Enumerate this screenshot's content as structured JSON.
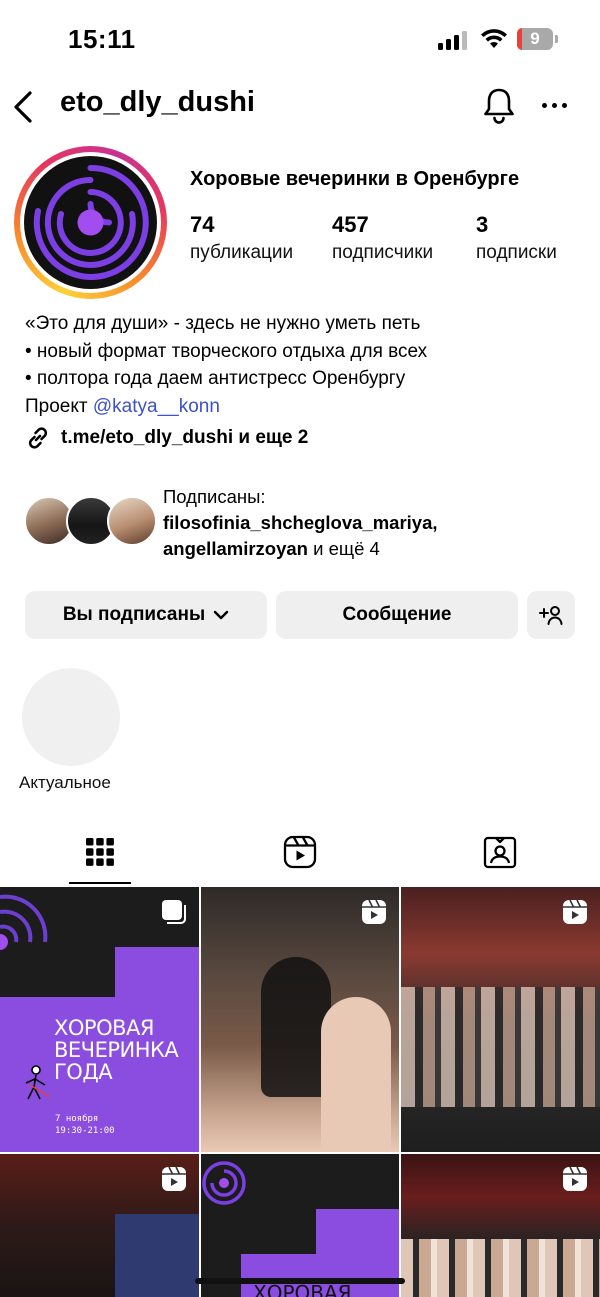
{
  "status_bar": {
    "time": "15:11",
    "battery": "9"
  },
  "header": {
    "username": "eto_dly_dushi"
  },
  "profile": {
    "name": "Хоровые вечеринки в Оренбурге",
    "stats": [
      {
        "value": "74",
        "label": "публикации"
      },
      {
        "value": "457",
        "label": "подписчики"
      },
      {
        "value": "3",
        "label": "подписки"
      }
    ],
    "bio_lines": [
      "«Это для души» - здесь не нужно уметь петь",
      "• новый формат творческого отдыха для всех",
      "• полтора года даем антистресс Оренбургу"
    ],
    "bio_project_prefix": "Проект ",
    "bio_mention": "@katya__konn",
    "link_text": "t.me/eto_dly_dushi и еще 2"
  },
  "followed_by": {
    "label": "Подписаны:",
    "names_line": "filosofinia_shcheglova_mariya,",
    "name2": "angellamirzoyan",
    "suffix": " и ещё 4"
  },
  "buttons": {
    "subscribed": "Вы подписаны",
    "message": "Сообщение"
  },
  "highlights": {
    "label": "Актуальное"
  },
  "tabs": [
    {
      "name": "posts",
      "icon": "grid-icon",
      "active": true
    },
    {
      "name": "reels",
      "icon": "reels-icon",
      "active": false
    },
    {
      "name": "tagged",
      "icon": "tagged-icon",
      "active": false
    }
  ],
  "grid_posts": {
    "post1": {
      "badge": "carousel-icon",
      "title_lines": [
        "ХОРОВАЯ",
        "ВЕЧЕРИНКА",
        "ГОДА"
      ],
      "date": "7 ноября",
      "time": "19:30-21:00"
    },
    "post2": {
      "badge": "reels-icon"
    },
    "post3": {
      "badge": "reels-icon"
    },
    "post4": {
      "badge": "reels-icon"
    },
    "post5": {
      "badge": "",
      "title": "ХОРОВАЯ"
    },
    "post6": {
      "badge": "reels-icon"
    }
  },
  "colors": {
    "accent_purple": "#8b4de0",
    "link_blue": "#3b52c4",
    "button_bg": "#efefef"
  }
}
